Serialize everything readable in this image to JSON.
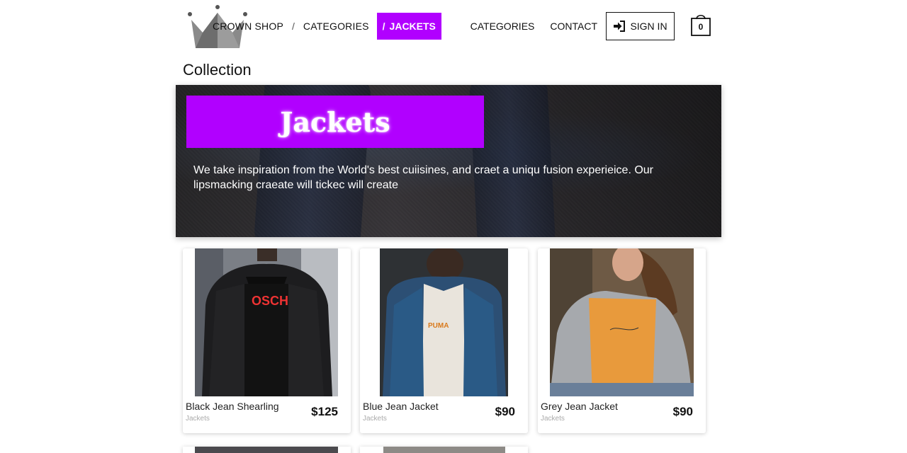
{
  "header": {
    "logo_icon": "crown-icon",
    "breadcrumb": [
      {
        "label": "CROWN SHOP"
      },
      {
        "label": "CATEGORIES"
      }
    ],
    "breadcrumb_separator": "/",
    "active_crumb_slash": "/",
    "active_crumb": "JACKETS",
    "nav": {
      "categories": "CATEGORIES",
      "contact": "CONTACT",
      "sign_in": "SIGN IN",
      "sign_in_icon": "sign-in-icon",
      "cart_icon": "shopping-bag-icon",
      "cart_count": "0"
    }
  },
  "page_title": "Collection",
  "banner": {
    "title": "Jackets",
    "description": "We take inspiration from the World's best cuiisines, and craet a uniqu fusion experieice. Our lipsmacking craeate will tickec will create"
  },
  "products": [
    {
      "name": "Black Jean Shearling",
      "category": "Jackets",
      "price": "$125"
    },
    {
      "name": "Blue Jean Jacket",
      "category": "Jackets",
      "price": "$90"
    },
    {
      "name": "Grey Jean Jacket",
      "category": "Jackets",
      "price": "$90"
    }
  ],
  "colors": {
    "accent": "#b100ff",
    "text": "#111111"
  }
}
